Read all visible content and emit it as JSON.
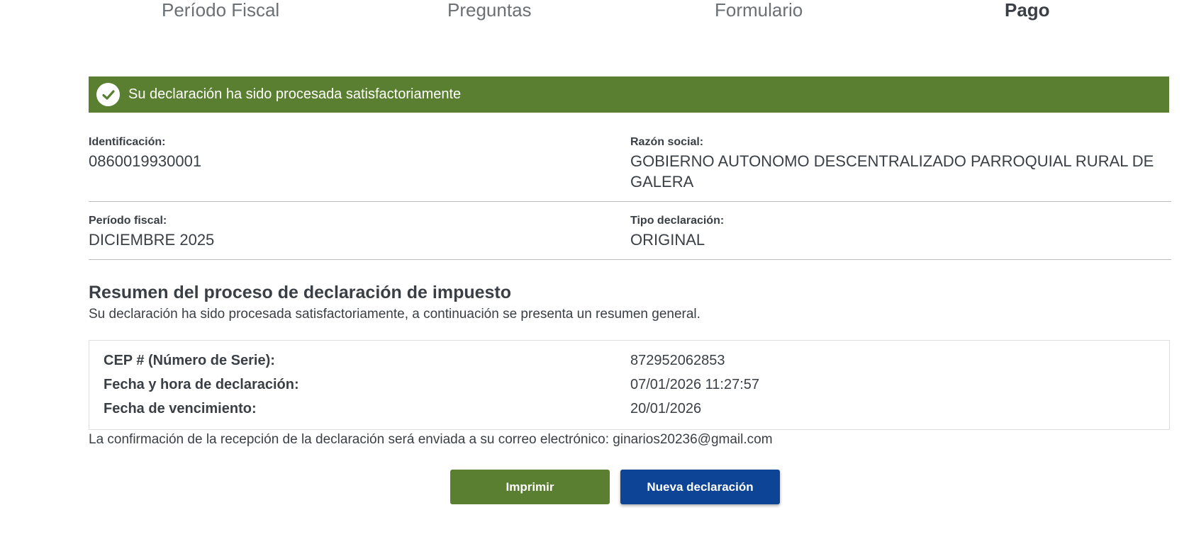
{
  "stepper": {
    "steps": [
      {
        "label": "Período Fiscal"
      },
      {
        "label": "Preguntas"
      },
      {
        "label": "Formulario"
      },
      {
        "label": "Pago"
      }
    ],
    "active_step": "Pago"
  },
  "banner": {
    "icon": "check-circle-icon",
    "message": "Su declaración ha sido procesada satisfactoriamente",
    "color": "#5a7f30"
  },
  "info": {
    "identificacion_label": "Identificación:",
    "identificacion_value": "0860019930001",
    "razon_social_label": "Razón social:",
    "razon_social_value": "GOBIERNO AUTONOMO DESCENTRALIZADO PARROQUIAL RURAL DE GALERA",
    "periodo_label": "Período fiscal:",
    "periodo_value": "DICIEMBRE 2025",
    "tipo_label": "Tipo declaración:",
    "tipo_value": "ORIGINAL"
  },
  "summary": {
    "title": "Resumen del proceso de declaración de impuesto",
    "subtitle": "Su declaración ha sido procesada satisfactoriamente, a continuación se presenta un resumen general.",
    "rows": [
      {
        "label": "CEP # (Número de Serie):",
        "value": "872952062853"
      },
      {
        "label": "Fecha y hora de declaración:",
        "value": "07/01/2026 11:27:57"
      },
      {
        "label": "Fecha de vencimiento:",
        "value": "20/01/2026"
      }
    ],
    "confirmation": "La confirmación de la recepción de la declaración será enviada a su correo electrónico: ginarios20236@gmail.com"
  },
  "actions": {
    "print_label": "Imprimir",
    "new_label": "Nueva declaración",
    "print_color": "#5a7f30",
    "new_color": "#0d4496"
  }
}
